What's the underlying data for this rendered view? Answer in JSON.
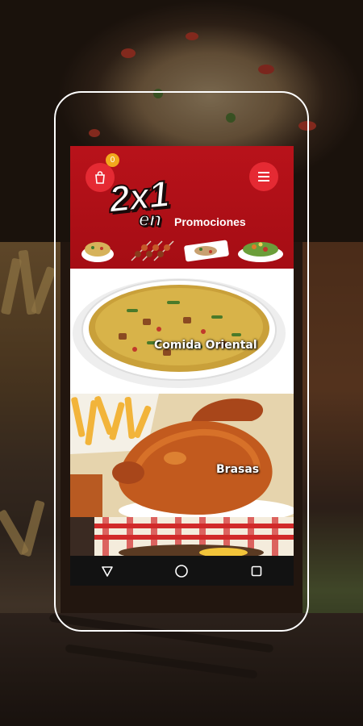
{
  "app": {
    "cart_badge": "0",
    "promo_title": "2x1",
    "promo_en": "en",
    "promo_subtitle": "Promociones"
  },
  "categories": [
    {
      "label": "Comida Oriental"
    },
    {
      "label": "Brasas"
    },
    {
      "label": ""
    }
  ],
  "nav": {
    "back_icon": "triangle-back-icon",
    "home_icon": "circle-home-icon",
    "recents_icon": "square-recents-icon"
  },
  "colors": {
    "header_red": "#b8121a",
    "button_red": "#e52a33",
    "badge_orange": "#f2a81d",
    "nav_black": "#121212",
    "frame_white": "#ffffff"
  }
}
